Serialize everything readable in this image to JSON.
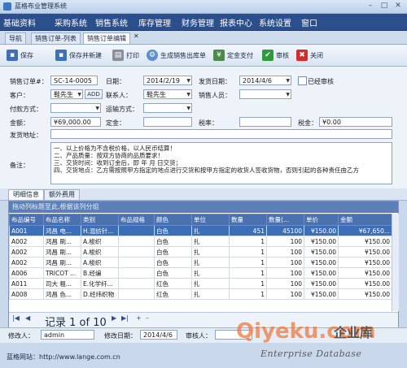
{
  "window": {
    "title": "蓝格布业管理系统",
    "min": "–",
    "max": "□",
    "close": "✕"
  },
  "menu": [
    "基础资料",
    "采购系统",
    "销售系统",
    "库存管理",
    "财务管理",
    "报表中心",
    "系统设置",
    "窗口"
  ],
  "doc_tabs": [
    {
      "label": "导航"
    },
    {
      "label": "销售订单-列表"
    },
    {
      "label": "销售订单编辑"
    }
  ],
  "doc_tab_close": "✕",
  "toolbar": {
    "save": "保存",
    "save_new": "保存并新建",
    "print": "打印",
    "gen_out": "生成销售出库单",
    "deposit": "定金支付",
    "audit": "审核",
    "close": "关闭"
  },
  "form": {
    "order_no_label": "销售订单#：",
    "order_no": "SC-14-0005",
    "date_label": "日期：",
    "date": "2014/2/19",
    "ship_date_label": "发货日期：",
    "ship_date": "2014/4/6",
    "audited_label": "已经审核",
    "customer_label": "客户：",
    "customer": "鞋先生",
    "add_label": "ADD",
    "contact_label": "联系人：",
    "contact": "鞋先生",
    "sales_label": "销售人员：",
    "sales": "",
    "pay_label": "付款方式：",
    "pay": "",
    "ship_method_label": "运输方式：",
    "ship_method": "",
    "amount_label": "金额：",
    "amount": "¥69,000.00",
    "deposit_label": "定金：",
    "deposit": "",
    "tax_rate_label": "税率：",
    "tax_rate": "",
    "tax_label": "税金：",
    "tax": "¥0.00",
    "address_label": "发货地址：",
    "address": "",
    "remark_label": "备注：",
    "remark_lines": [
      "一、以上价格为不含税价格，以人民币结算！",
      "二、产品质量：按双方协商的品质要求！",
      "三、交货时间：收到订金后，即        年        月        日交货；",
      "四、交货地点：乙方需按照甲方指定的地点进行交货和按甲方指定的收货人签收货物，否则引起的各种责任由乙方"
    ]
  },
  "sub_tabs": [
    "明细信息",
    "额外费用"
  ],
  "grid": {
    "group_hint": "拖动列标题至此,根据该列分组",
    "columns": [
      "布品编号",
      "布品名称",
      "类别",
      "布品规格",
      "颜色",
      "单位",
      "数量",
      "数量(...",
      "单价",
      "金额"
    ],
    "rows": [
      [
        "A001",
        "鸿昌 电...",
        "H.混纺针...",
        "",
        "白色",
        "扎",
        "451",
        "45100",
        "¥150.00",
        "¥67,650..."
      ],
      [
        "A002",
        "鸿昌 刷...",
        "A.梭织",
        "",
        "白色",
        "扎",
        "1",
        "100",
        "¥150.00",
        "¥150.00"
      ],
      [
        "A002",
        "鸿昌 刷...",
        "A.梭织",
        "",
        "白色",
        "扎",
        "1",
        "100",
        "¥150.00",
        "¥150.00"
      ],
      [
        "A002",
        "鸿昌 刷...",
        "A.梭织",
        "",
        "白色",
        "扎",
        "1",
        "100",
        "¥150.00",
        "¥150.00"
      ],
      [
        "A006",
        "TRICOT ...",
        "B.经编",
        "",
        "白色",
        "扎",
        "1",
        "100",
        "¥150.00",
        "¥150.00"
      ],
      [
        "A011",
        "司大 粗...",
        "E.化学纤...",
        "",
        "红色",
        "扎",
        "1",
        "100",
        "¥150.00",
        "¥150.00"
      ],
      [
        "A008",
        "鸿昌 色...",
        "D.经纬织物",
        "",
        "红色",
        "扎",
        "1",
        "100",
        "¥150.00",
        "¥150.00"
      ]
    ],
    "nav_record": "记录 1 of 10"
  },
  "status": {
    "modifier_label": "修改人：",
    "modifier": "admin",
    "modify_date_label": "修改日期：",
    "modify_date": "2014/4/6",
    "auditor_label": "审核人："
  },
  "footer": {
    "website": "蓝格网站：http://www.lange.com.cn"
  },
  "watermark": {
    "brand": "Qiyeku.com",
    "cn": "企业库",
    "en": "Enterprise Database"
  }
}
